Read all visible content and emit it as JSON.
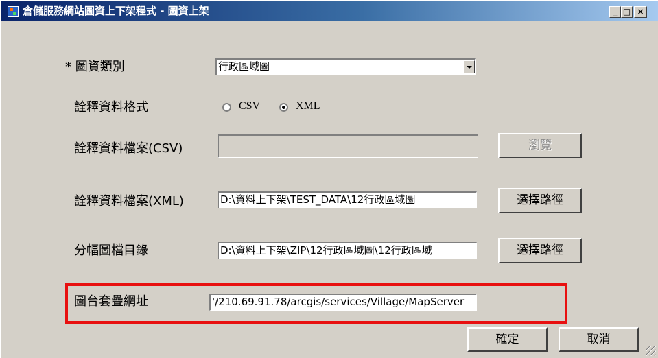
{
  "window": {
    "title": "倉儲服務網站圖資上下架程式 - 圖資上架",
    "controls": {
      "minimize": "_",
      "maximize": "□",
      "close": "×"
    }
  },
  "form": {
    "category": {
      "label": "* 圖資類別",
      "value": "行政區域圖"
    },
    "format": {
      "label": "詮釋資料格式",
      "options": [
        {
          "label": "CSV",
          "selected": false
        },
        {
          "label": "XML",
          "selected": true
        }
      ]
    },
    "csv_file": {
      "label": "詮釋資料檔案(CSV)",
      "value": "",
      "button": "瀏覽"
    },
    "xml_file": {
      "label": "詮釋資料檔案(XML)",
      "value": "D:\\資料上下架\\TEST_DATA\\12行政區域圖",
      "button": "選擇路徑"
    },
    "tile_dir": {
      "label": "分幅圖檔目錄",
      "value": "D:\\資料上下架\\ZIP\\12行政區域圖\\12行政區域",
      "button": "選擇路徑"
    },
    "map_url": {
      "label": "圖台套疊網址",
      "value": "'/210.69.91.78/arcgis/services/Village/MapServer"
    }
  },
  "actions": {
    "ok": "確定",
    "cancel": "取消"
  },
  "colors": {
    "highlight": "#e81010",
    "titlebar": "#0a246a",
    "window": "#d4d0c8"
  }
}
